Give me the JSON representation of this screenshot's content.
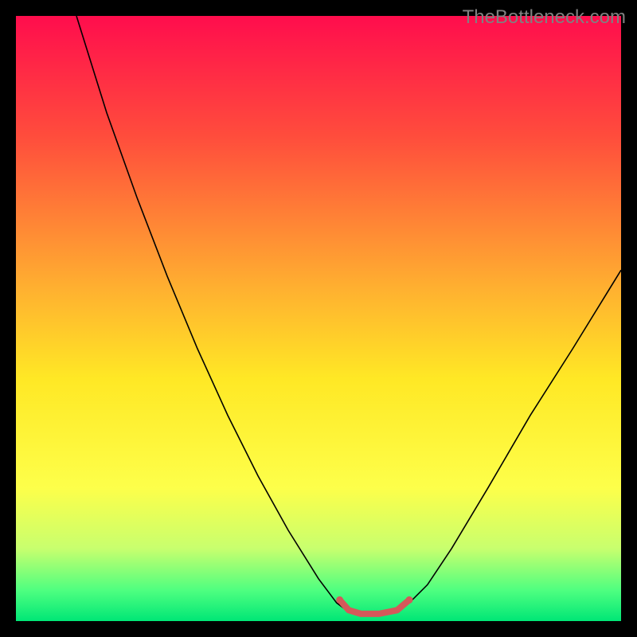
{
  "watermark": "TheBottleneck.com",
  "chart_data": {
    "type": "line",
    "title": "",
    "xlabel": "",
    "ylabel": "",
    "xlim": [
      0,
      100
    ],
    "ylim": [
      0,
      100
    ],
    "background_gradient_stops": [
      {
        "offset": 0,
        "color": "#ff0d4d"
      },
      {
        "offset": 20,
        "color": "#ff4d3c"
      },
      {
        "offset": 45,
        "color": "#ffb030"
      },
      {
        "offset": 60,
        "color": "#ffe825"
      },
      {
        "offset": 78,
        "color": "#fdff4a"
      },
      {
        "offset": 88,
        "color": "#c8ff6e"
      },
      {
        "offset": 95,
        "color": "#4dff80"
      },
      {
        "offset": 100,
        "color": "#00e676"
      }
    ],
    "series": [
      {
        "name": "bottleneck-curve",
        "color": "#000000",
        "width": 1.6,
        "points": [
          {
            "x": 10,
            "y": 100
          },
          {
            "x": 15,
            "y": 84
          },
          {
            "x": 20,
            "y": 70
          },
          {
            "x": 25,
            "y": 57
          },
          {
            "x": 30,
            "y": 45
          },
          {
            "x": 35,
            "y": 34
          },
          {
            "x": 40,
            "y": 24
          },
          {
            "x": 45,
            "y": 15
          },
          {
            "x": 50,
            "y": 7
          },
          {
            "x": 53,
            "y": 3
          },
          {
            "x": 55,
            "y": 1.5
          },
          {
            "x": 57,
            "y": 1
          },
          {
            "x": 60,
            "y": 1
          },
          {
            "x": 63,
            "y": 1.5
          },
          {
            "x": 65,
            "y": 3
          },
          {
            "x": 68,
            "y": 6
          },
          {
            "x": 72,
            "y": 12
          },
          {
            "x": 78,
            "y": 22
          },
          {
            "x": 85,
            "y": 34
          },
          {
            "x": 92,
            "y": 45
          },
          {
            "x": 100,
            "y": 58
          }
        ]
      },
      {
        "name": "marker-segment",
        "color": "#d5585a",
        "width": 8,
        "linecap": "round",
        "points": [
          {
            "x": 53.5,
            "y": 3.5
          },
          {
            "x": 55,
            "y": 1.8
          },
          {
            "x": 57,
            "y": 1.2
          },
          {
            "x": 60,
            "y": 1.2
          },
          {
            "x": 63,
            "y": 1.8
          },
          {
            "x": 65,
            "y": 3.5
          }
        ]
      }
    ]
  }
}
